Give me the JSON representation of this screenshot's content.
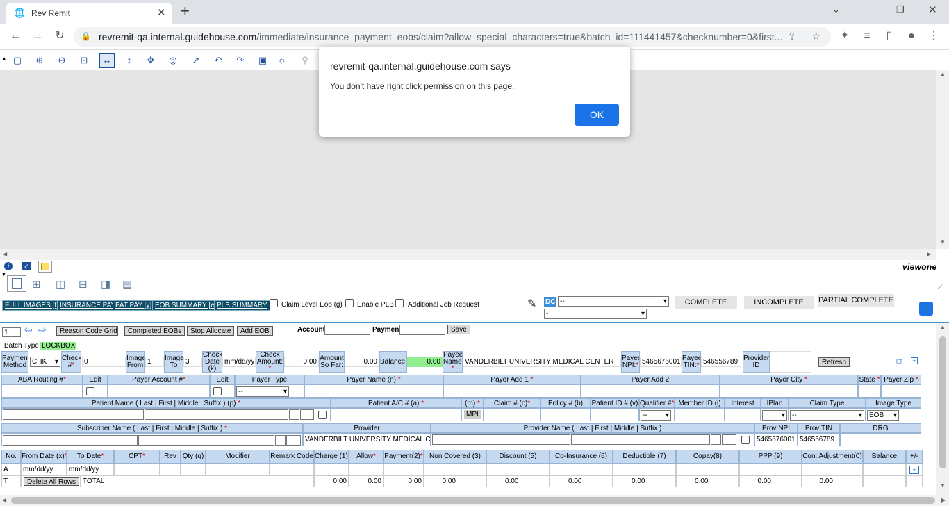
{
  "browser": {
    "tab_title": "Rev Remit",
    "new_tab": "+",
    "url_domain": "revremit-qa.internal.guidehouse.com",
    "url_path": "/immediate/insurance_payment_eobs/claim?allow_special_characters=true&batch_id=111441457&checknumber=0&first..."
  },
  "dialog": {
    "title": "revremit-qa.internal.guidehouse.com says",
    "message": "You don't have right click permission on this page.",
    "ok_label": "OK"
  },
  "viewer": {
    "brand": "viewone"
  },
  "tabs": {
    "full_images": "FULL IMAGES [f]",
    "insurance_pay": "INSURANCE PAY",
    "pat_pay": "PAT PAY [y]",
    "eob_summary": "EOB SUMMARY [e]",
    "plb_summary": "PLB SUMMARY",
    "claim_level_eob": "Claim Level Eob (g)",
    "enable_plb": "Enable PLB",
    "additional_job": "Additional Job Request",
    "dc_badge": "DC",
    "dc_select": "--",
    "dc_select2": "-",
    "complete": "COMPLETE",
    "incomplete": "INCOMPLETE",
    "partial_complete": "PARTIAL COMPLETE"
  },
  "actions": {
    "page_number": "1",
    "reason_code_grid": "Reason Code Grid",
    "completed_eobs": "Completed EOBs",
    "stop_allocate": "Stop Allocate",
    "add_eob": "Add EOB",
    "account_label": "Account",
    "payment_label": "Payment",
    "save": "Save",
    "batch_type_label": "Batch Type",
    "batch_type_value": "LOCKBOX"
  },
  "check": {
    "payment_method_label": "Payment Method",
    "payment_method_value": "CHK",
    "check_no_label": "Check #",
    "check_no_value": "0",
    "image_from_label": "Image From",
    "image_from_value": "1",
    "image_to_label": "Image To",
    "image_to_value": "3",
    "check_date_label": "Check Date (k)",
    "check_date_value": "mm/dd/yy",
    "check_amount_label": "Check Amount:",
    "check_amount_value": "0.00",
    "amount_so_far_label": "Amount So Far:",
    "amount_so_far_value": "0.00",
    "balance_label": "Balance:",
    "balance_value": "0.00",
    "payee_name_label": "Payee Name:",
    "payee_name_value": "VANDERBILT UNIVERSITY MEDICAL CENTER",
    "payee_npi_label": "Payee NPI:",
    "payee_npi_value": "5465676001",
    "payee_tin_label": "Payee TIN:",
    "payee_tin_value": "546556789",
    "provider_id_label": "Provider ID",
    "refresh": "Refresh"
  },
  "payer": {
    "headers": [
      "ABA Routing #",
      "Edit",
      "Payer Account #",
      "Edit",
      "Payer Type",
      "Payer Name (n)",
      "Payer Add 1",
      "Payer Add 2",
      "Payer City",
      "State",
      "Payer Zip"
    ],
    "payer_type_value": "--"
  },
  "patient": {
    "headers": [
      "Patient Name ( Last | First | Middle | Suffix ) (p)",
      "Patient A/C # (a)",
      "(m)",
      "Claim # (c)",
      "Policy # (b)",
      "Patient ID # (v)",
      "Qualifier #",
      "Member ID (i)",
      "Interest",
      "IPlan",
      "Claim Type",
      "Image Type"
    ],
    "mpi": "MPI",
    "qualifier_value": "--",
    "claim_type_value": "--",
    "image_type_value": "EOB"
  },
  "subscriber": {
    "headers": [
      "Subscriber Name ( Last | First | Middle | Suffix )",
      "Provider",
      "Provider Name ( Last | First | Middle | Suffix )",
      "Prov NPI",
      "Prov TIN",
      "DRG"
    ],
    "provider_value": "VANDERBILT UNIVERSITY MEDICAL C",
    "prov_npi_value": "5465676001",
    "prov_tin_value": "546556789"
  },
  "service": {
    "headers": [
      "No.",
      "From Date (x)",
      "To Date",
      "CPT",
      "Rev",
      "Qty (q)",
      "Modifier",
      "Remark Code",
      "Charge (1)",
      "Allow",
      "Payment(2)",
      "Non Covered (3)",
      "Discount (5)",
      "Co-Insurance (6)",
      "Deductible (7)",
      "Copay(8)",
      "PPP (9)",
      "Con: Adjustment(0)",
      "Balance",
      "+/-"
    ],
    "row_a": {
      "no": "A",
      "from": "mm/dd/yy",
      "to": "mm/dd/yy"
    },
    "row_t": {
      "no": "T",
      "delete_all": "Delete All Rows",
      "total": "TOTAL",
      "zero": "0.00"
    },
    "plus": "+"
  }
}
